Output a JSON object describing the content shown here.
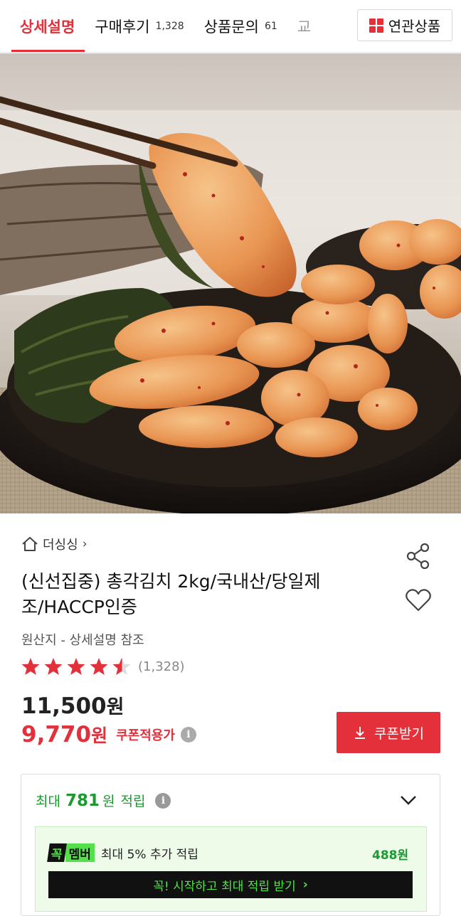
{
  "tabs": {
    "detail": "상세설명",
    "reviews": "구매후기",
    "reviews_count": "1,328",
    "qna": "상품문의",
    "qna_count": "61",
    "exchange_partial": "교",
    "related": "연관상품"
  },
  "product": {
    "brand": "더싱싱",
    "brand_chevron": "›",
    "title": "(신선집중) 총각김치 2kg/국내산/당일제조/HACCP인증",
    "origin": "원산지 - 상세설명 참조",
    "rating": 4.5,
    "rating_count": "(1,328)",
    "original_price": "11,500",
    "sale_price": "9,770",
    "currency": "원",
    "coupon_applied_label": "쿠폰적용가",
    "coupon_button": "쿠폰받기",
    "info_glyph": "i"
  },
  "reward": {
    "prefix": "최대",
    "amount": "781",
    "unit": "원",
    "suffix": "적립",
    "member_badge_a": "꼭",
    "member_badge_b": "멤버",
    "member_text": "최대 5% 추가 적립",
    "member_amount": "488원",
    "cta": "꼭! 시작하고 최대 적립 받기",
    "cta_arrow": "›"
  },
  "colors": {
    "accent": "#e3303a",
    "green": "#1b9a2f",
    "member_green": "#53e04a"
  }
}
